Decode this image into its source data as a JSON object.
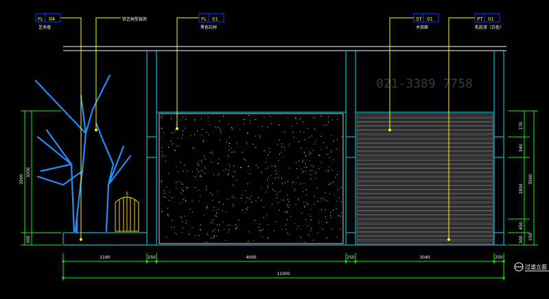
{
  "drawing": {
    "watermark_phone": "021-3389 7758",
    "title_label": "过道立面",
    "colors": {
      "background": "#000000",
      "wall_lines": "#00bcd4",
      "leaders": "#ffff00",
      "dimensions": "#00ff00",
      "tags": "#0044ff",
      "outline": "#ffffff",
      "watermark": "#3a3a3a"
    },
    "tags": [
      {
        "left": "FL",
        "right": "04",
        "note": "艺术墙"
      },
      {
        "left": "",
        "right": "",
        "note": "铁艺树型装饰"
      },
      {
        "left": "FL",
        "right": "01",
        "note": "黑色石材"
      },
      {
        "left": "ST",
        "right": "01",
        "note": "木饰面"
      },
      {
        "left": "PT",
        "right": "01",
        "note": "乳胶漆（白色）"
      }
    ],
    "bottom_dims": [
      "2190",
      "250",
      "4000",
      "250",
      "3040",
      "250"
    ],
    "overall_dim": "11000",
    "left_dims": {
      "total": "3500",
      "upper": "3200",
      "base": "300"
    },
    "right_dims": {
      "top": "170",
      "mid": "540",
      "main": "3500",
      "lower": "1850",
      "a": "450",
      "b": "300",
      "c": "250"
    }
  }
}
